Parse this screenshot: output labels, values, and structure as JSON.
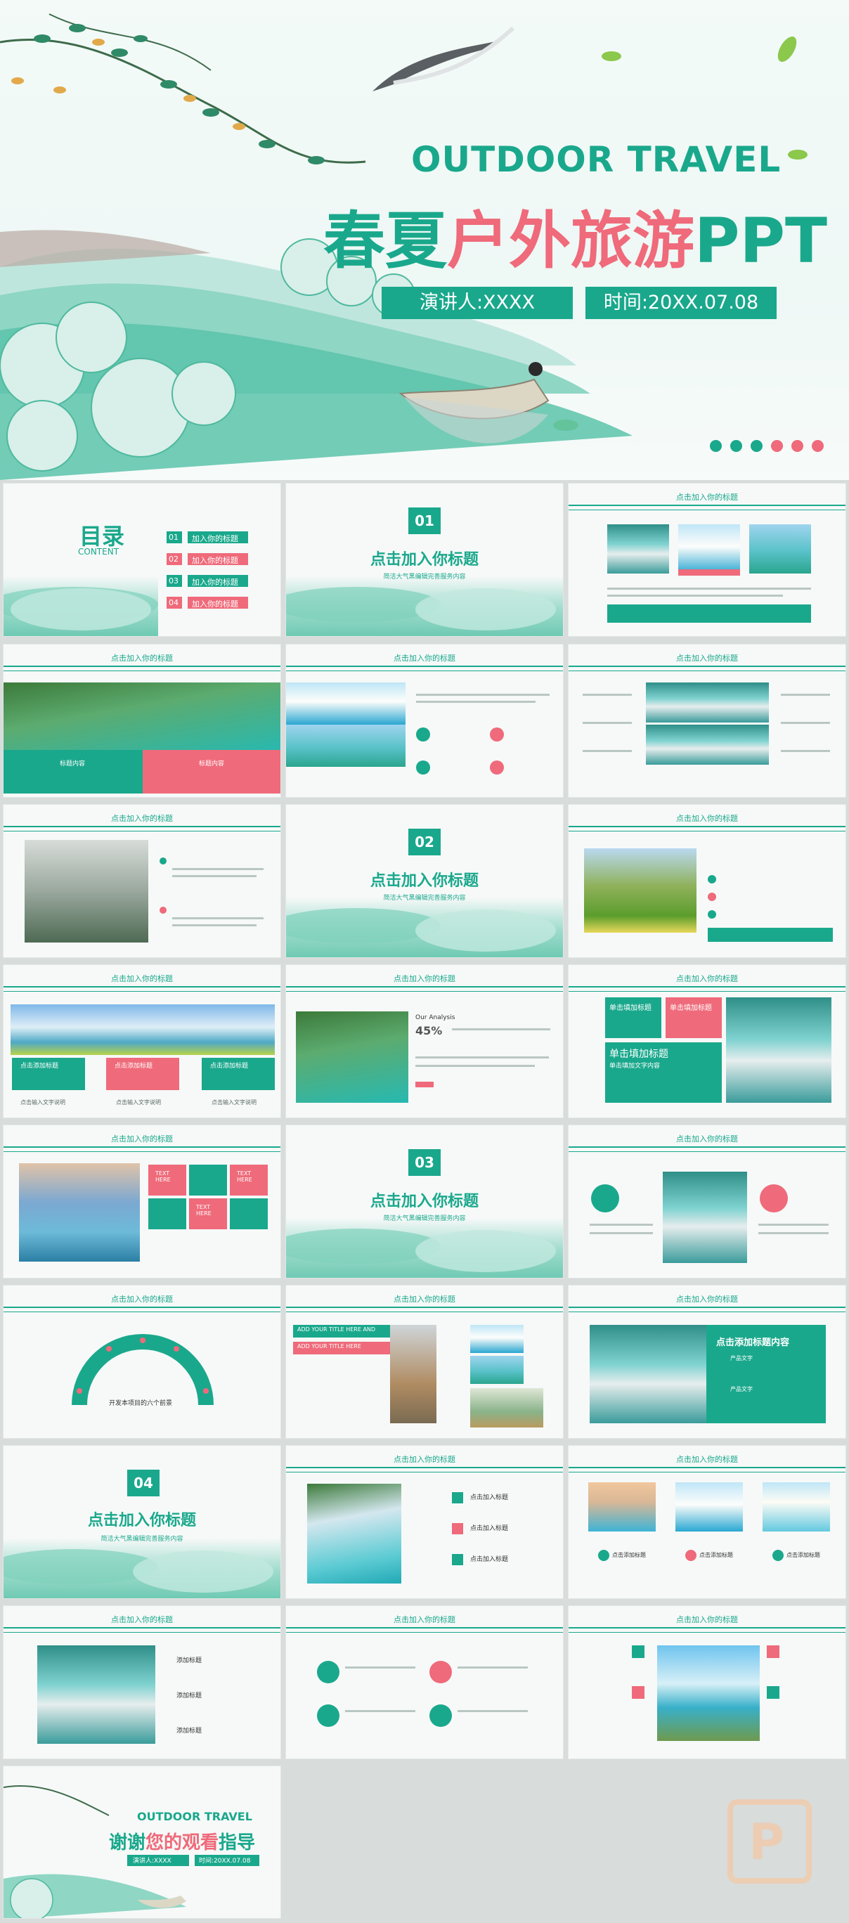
{
  "cover": {
    "title_en": "OUTDOOR TRAVEL",
    "title_cn_a": "春夏",
    "title_cn_b": "户外旅游",
    "title_cn_c": "PPT",
    "speaker": "演讲人:XXXX",
    "time": "时间:20XX.07.08",
    "colors": {
      "accent": "#1aa88c",
      "pink": "#ef6a7a"
    }
  },
  "toc": {
    "title": "目录",
    "subtitle": "CONTENT",
    "items": [
      {
        "num": "01",
        "label": "加入你的标题"
      },
      {
        "num": "02",
        "label": "加入你的标题"
      },
      {
        "num": "03",
        "label": "加入你的标题"
      },
      {
        "num": "04",
        "label": "加入你的标题"
      }
    ]
  },
  "header": "点击加入你的标题",
  "sections": [
    {
      "num": "01",
      "title": "点击加入你标题",
      "sub": "简洁大气黑编辑完善服务内容"
    },
    {
      "num": "02",
      "title": "点击加入你标题",
      "sub": "简洁大气黑编辑完善服务内容"
    },
    {
      "num": "03",
      "title": "点击加入你标题",
      "sub": "简洁大气黑编辑完善服务内容"
    },
    {
      "num": "04",
      "title": "点击加入你标题",
      "sub": "简洁大气黑编辑完善服务内容"
    }
  ],
  "labels": {
    "content_tag": "标题内容",
    "add_title": "点击添加标题",
    "add_text": "点击输入文字说明",
    "our_analysis": "Our Analysis",
    "pct": "45%",
    "click_fill": "单击填加标题",
    "click_fill_sub": "单击填加文字内容",
    "text_here": "TEXT HERE",
    "six_points": "开发本项目的六个前景",
    "add_title_en": "ADD YOUR TITLE HERE AND",
    "add_title_en2": "ADD YOUR TITLE HERE",
    "add_content": "点击添加标题内容",
    "product_text": "产品文字",
    "add_headline": "添加标题",
    "click_add_title": "点击加入标题",
    "add_click_title": "点击添加标题",
    "please_add": "单击填加标题"
  },
  "ending": {
    "title_en": "OUTDOOR TRAVEL",
    "title_a": "谢谢",
    "title_b": "您的观看",
    "title_c": "指导",
    "speaker": "演讲人:XXXX",
    "time": "时间:20XX.07.08"
  }
}
